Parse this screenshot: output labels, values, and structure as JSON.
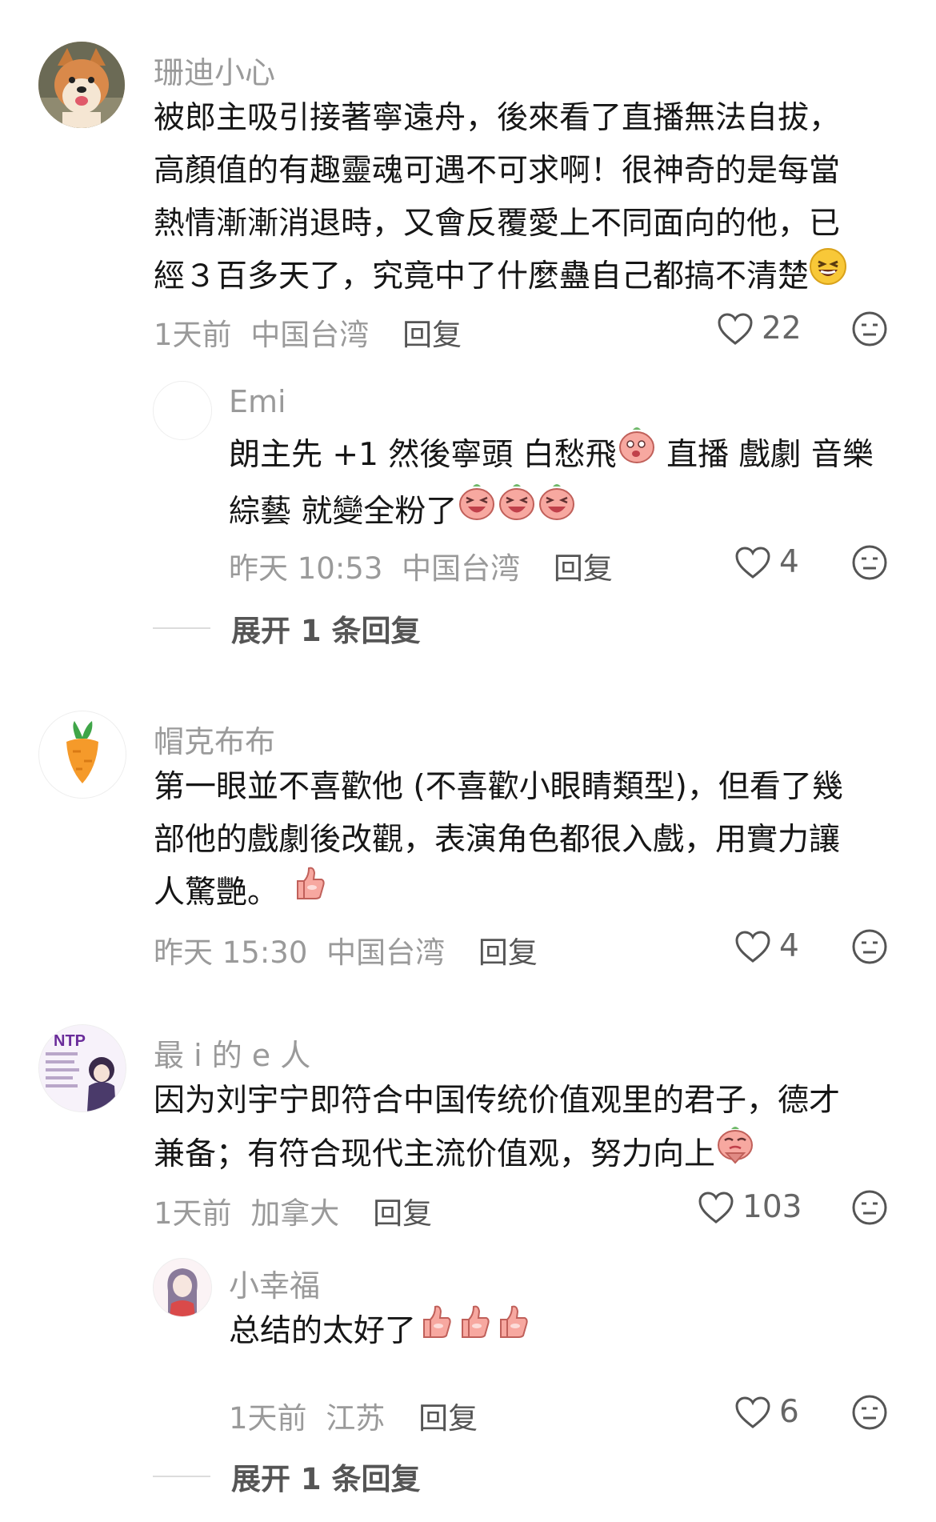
{
  "comments": [
    {
      "username": "珊迪小心",
      "lines": [
        "被郎主吸引接著寧遠舟，後來看了直播無法自拔，",
        "高顏值的有趣靈魂可遇不可求啊！很神奇的是每當",
        "熱情漸漸消退時，又會反覆愛上不同面向的他，已",
        "經３百多天了，究竟中了什麼蠱自己都搞不清楚"
      ],
      "time": "1天前",
      "location": "中国台湾",
      "reply_label": "回复",
      "likes": "22",
      "avatar_icon": "shiba-dog-avatar",
      "replies": [
        {
          "username": "Emi",
          "lines": [
            "朗主先 +1 然後寧頭 白愁飛",
            " 直播 戲劇 音樂",
            "綜藝 就變全粉了"
          ],
          "time": "昨天 10:53",
          "location": "中国台湾",
          "reply_label": "回复",
          "likes": "4"
        }
      ],
      "expand_label": "展开 1 条回复"
    },
    {
      "username": "帽克布布",
      "lines": [
        "第一眼並不喜歡他 (不喜歡小眼睛類型)，但看了幾",
        "部他的戲劇後改觀，表演角色都很入戲，用實力讓",
        "人驚艷。"
      ],
      "time": "昨天 15:30",
      "location": "中国台湾",
      "reply_label": "回复",
      "likes": "4",
      "avatar_icon": "carrot-avatar"
    },
    {
      "username": "最 i 的 e 人",
      "lines": [
        "因为刘宇宁即符合中国传统价值观里的君子，德才",
        "兼备；有符合现代主流价值观，努力向上"
      ],
      "time": "1天前",
      "location": "加拿大",
      "reply_label": "回复",
      "likes": "103",
      "avatar_text": "NTP",
      "replies": [
        {
          "username": "小幸福",
          "lines": [
            "总结的太好了"
          ],
          "time": "1天前",
          "location": "江苏",
          "reply_label": "回复",
          "likes": "6"
        }
      ],
      "expand_label": "展开 1 条回复"
    }
  ],
  "colors": {
    "username": "#9a9a9a",
    "text": "#161616",
    "meta": "#9a9a9a",
    "emoji_pink": "#f7a8a0",
    "emoji_yellow": "#f8c838"
  }
}
